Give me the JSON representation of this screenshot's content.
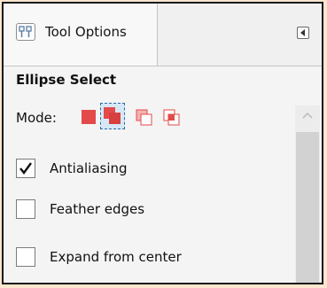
{
  "tab": {
    "label": "Tool Options",
    "icon": "tool-options-icon"
  },
  "panel": {
    "menu_icon": "panel-menu-arrow-icon"
  },
  "tool": {
    "title": "Ellipse Select"
  },
  "mode": {
    "label": "Mode:",
    "options": [
      "replace",
      "add",
      "subtract",
      "intersect"
    ],
    "selected": "add"
  },
  "options": {
    "antialiasing": {
      "label": "Antialiasing",
      "checked": true
    },
    "feather_edges": {
      "label": "Feather edges",
      "checked": false
    },
    "expand_from_center": {
      "label": "Expand from center",
      "checked": false
    }
  },
  "colors": {
    "mode_red": "#e34a4a",
    "selection_blue": "#2b6ca3",
    "frame": "#1a1a1a"
  }
}
